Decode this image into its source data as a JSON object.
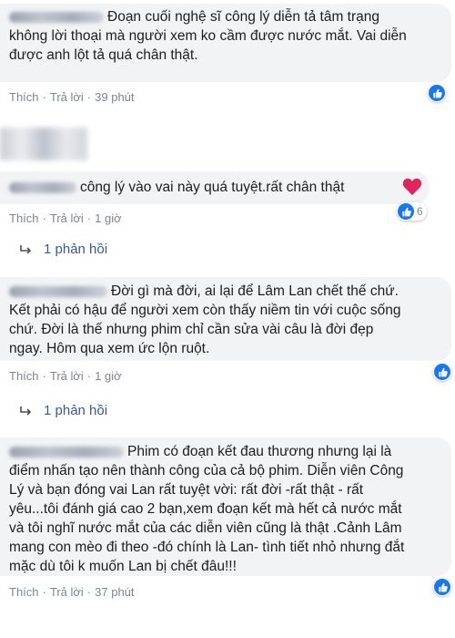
{
  "comments": [
    {
      "lines": [
        "Đoạn cuối nghệ sĩ công lý diễn tả tâm trạng",
        "không lời thoại mà người xem ko cầm được nước mắt. Vai diễn",
        "được anh lột tả quá chân thật."
      ],
      "like": "Thích",
      "reply": "Trả lời",
      "time": "39 phút"
    },
    {
      "lines": [
        "công lý vào vai này quá tuyệt.rất chân thật"
      ],
      "like": "Thích",
      "reply": "Trả lời",
      "time": "1 giờ",
      "reaction_count": "6",
      "replies": "1 phản hồi"
    },
    {
      "lines": [
        "Đời gì mà đời, ai lại để Lâm Lan chết thế chứ.",
        "Kết phải có hậu để người xem còn thấy niềm tin với cuộc sống",
        "chứ. Đời là thế nhưng phim chỉ cần sửa vài câu là đời đẹp",
        "ngay. Hôm qua xem ức lộn ruột."
      ],
      "like": "Thích",
      "reply": "Trả lời",
      "time": "1 giờ",
      "replies": "1 phản hồi"
    },
    {
      "lines": [
        "Phim có đoạn kết đau thương nhưng lại là",
        "điểm nhấn tạo nên thành công của cả bộ phim. Diễn viên Công",
        "Lý và bạn đóng vai Lan rất tuyệt vời: rất đời -rất thật - rất",
        "yêu...tôi đánh giá cao 2 bạn,xem đoạn kết mà hết cả nước mắt",
        "và tôi nghĩ nước mắt của các diễn viên cũng là thật .Cảnh Lâm",
        "mang con mèo đi theo -đó chính là Lan- tình tiết nhỏ nhưng đắt",
        "mặc dù tôi k muốn Lan bị chết đâu!!!"
      ],
      "like": "Thích",
      "reply": "Trả lời",
      "time": "37 phút"
    }
  ],
  "colors": {
    "bubble": "#f2f3f5",
    "meta": "#7f8590",
    "link": "#385898",
    "like_blue": "#1877f2",
    "heart_red": "#e0245e"
  },
  "icons": {
    "like": "thumbs-up-icon",
    "love": "heart-icon",
    "reply_arrow": "reply-arrow-icon"
  }
}
